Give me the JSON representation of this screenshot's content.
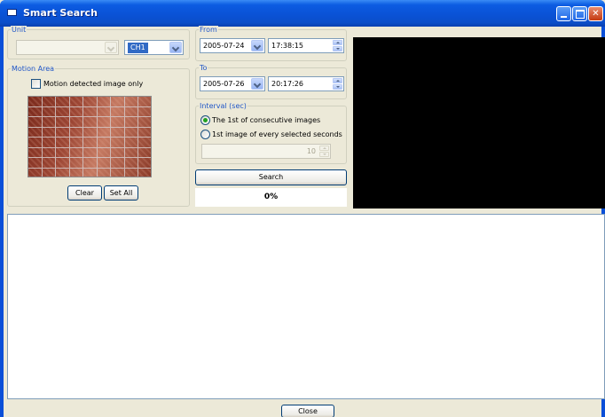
{
  "window": {
    "title": "Smart Search",
    "buttons": [
      "minimize",
      "maximize",
      "close"
    ]
  },
  "unit": {
    "label": "Unit",
    "device_value": "",
    "channel_value": "CH1"
  },
  "motion_area": {
    "label": "Motion Area",
    "only_checkbox_label": "Motion detected image only",
    "only_checkbox_checked": false,
    "grid_rows": 8,
    "grid_cols": 9,
    "clear_button": "Clear",
    "set_all_button": "Set All"
  },
  "from": {
    "label": "From",
    "date": "2005-07-24",
    "time": "17:38:15"
  },
  "to": {
    "label": "To",
    "date": "2005-07-26",
    "time": "20:17:26"
  },
  "interval": {
    "label": "Interval (sec)",
    "option1": "The 1st of consecutive images",
    "option2": "1st image of every selected seconds",
    "selected_option": 1,
    "seconds_value": "10"
  },
  "search_button": "Search",
  "progress": {
    "text": "0%",
    "value": 0
  },
  "close_button": "Close",
  "colors": {
    "titlebar": "#0a52d6",
    "group_label": "#2056c7",
    "selection": "#316ac5",
    "radio_dot": "#21a121"
  }
}
